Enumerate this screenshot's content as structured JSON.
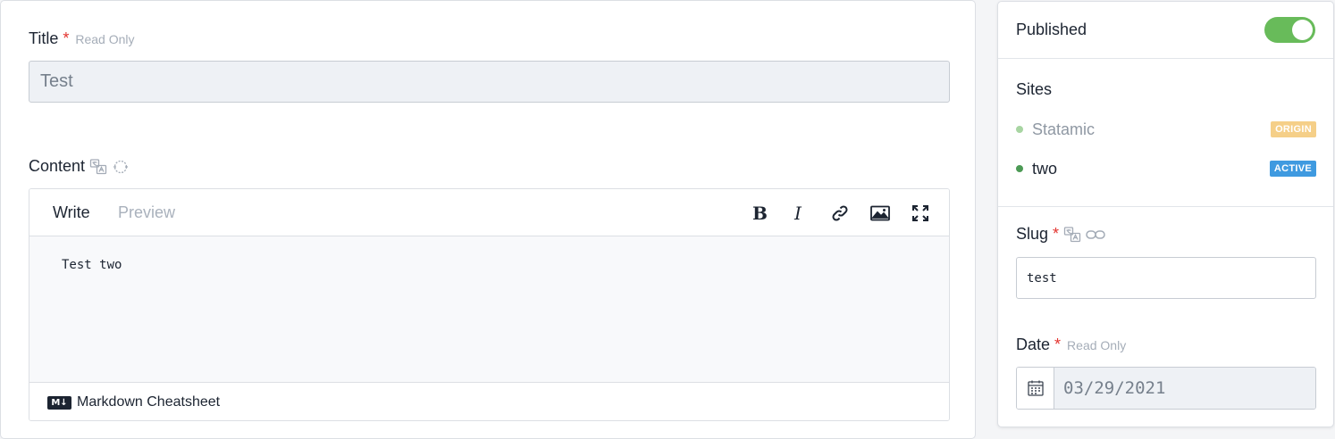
{
  "title_field": {
    "label": "Title",
    "required_mark": "*",
    "read_only_label": "Read Only",
    "value": "Test"
  },
  "content_field": {
    "label": "Content",
    "tabs": {
      "write": "Write",
      "preview": "Preview"
    },
    "toolbar_icons": [
      "bold-icon",
      "italic-icon",
      "link-icon",
      "image-icon",
      "fullscreen-icon"
    ],
    "text": "Test two",
    "footer_badge": "M↓",
    "footer_link": "Markdown Cheatsheet"
  },
  "sidebar": {
    "published": {
      "label": "Published",
      "enabled": true,
      "color": "#68bb5a"
    },
    "sites": {
      "title": "Sites",
      "items": [
        {
          "name": "Statamic",
          "badge": "ORIGIN",
          "badge_color": "#f5cf88",
          "dot_color": "#a8d5a2",
          "name_color": "#8f98a3"
        },
        {
          "name": "two",
          "badge": "ACTIVE",
          "badge_color": "#3f9ae0",
          "dot_color": "#4c9a55",
          "name_color": "#1c2431"
        }
      ]
    },
    "slug": {
      "label": "Slug",
      "required_mark": "*",
      "value": "test"
    },
    "date": {
      "label": "Date",
      "required_mark": "*",
      "read_only_label": "Read Only",
      "value": "03/29/2021"
    }
  }
}
